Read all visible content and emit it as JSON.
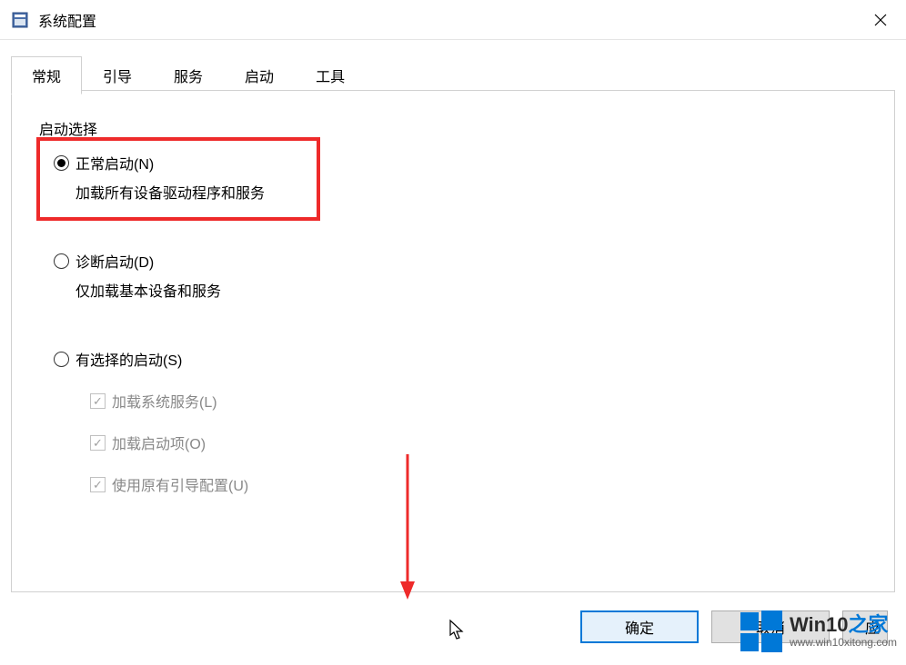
{
  "window": {
    "title": "系统配置"
  },
  "tabs": [
    {
      "label": "常规",
      "active": true
    },
    {
      "label": "引导",
      "active": false
    },
    {
      "label": "服务",
      "active": false
    },
    {
      "label": "启动",
      "active": false
    },
    {
      "label": "工具",
      "active": false
    }
  ],
  "group": {
    "title": "启动选择",
    "options": [
      {
        "label": "正常启动(N)",
        "description": "加载所有设备驱动程序和服务",
        "checked": true
      },
      {
        "label": "诊断启动(D)",
        "description": "仅加载基本设备和服务",
        "checked": false
      },
      {
        "label": "有选择的启动(S)",
        "checked": false,
        "checkboxes": [
          {
            "label": "加载系统服务(L)",
            "checked": true,
            "disabled": true
          },
          {
            "label": "加载启动项(O)",
            "checked": true,
            "disabled": true
          },
          {
            "label": "使用原有引导配置(U)",
            "checked": true,
            "disabled": true
          }
        ]
      }
    ]
  },
  "buttons": {
    "ok": "确定",
    "cancel": "取消",
    "apply": "应"
  },
  "watermark": {
    "main_prefix": "Win10",
    "main_suffix": "之家",
    "url": "www.win10xitong.com"
  }
}
